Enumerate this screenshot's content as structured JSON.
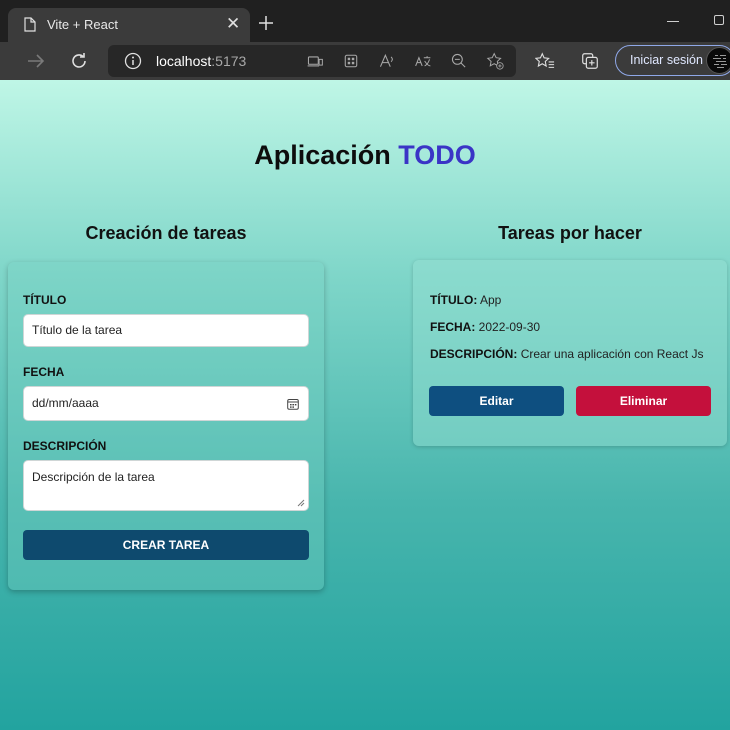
{
  "browser": {
    "tab_title": "Vite + React",
    "address_host": "localhost",
    "address_port": ":5173",
    "signin_label": "Iniciar sesión"
  },
  "app": {
    "title_main": "Aplicación ",
    "title_accent": "TODO",
    "accent_color": "#3a34c6"
  },
  "form": {
    "heading": "Creación de tareas",
    "title_label": "TÍTULO",
    "title_placeholder": "Título de la tarea",
    "date_label": "FECHA",
    "date_placeholder": "dd/mm/aaaa",
    "desc_label": "DESCRIPCIÓN",
    "desc_placeholder": "Descripción de la tarea",
    "submit_label": "CREAR TAREA"
  },
  "tasks": {
    "heading": "Tareas por hacer",
    "items": [
      {
        "title_label": "TÍTULO:",
        "title": "App",
        "date_label": "FECHA:",
        "date": "2022-09-30",
        "desc_label": "DESCRIPCIÓN:",
        "desc": "Crear una aplicación con React Js",
        "edit_label": "Editar",
        "delete_label": "Eliminar"
      }
    ]
  }
}
